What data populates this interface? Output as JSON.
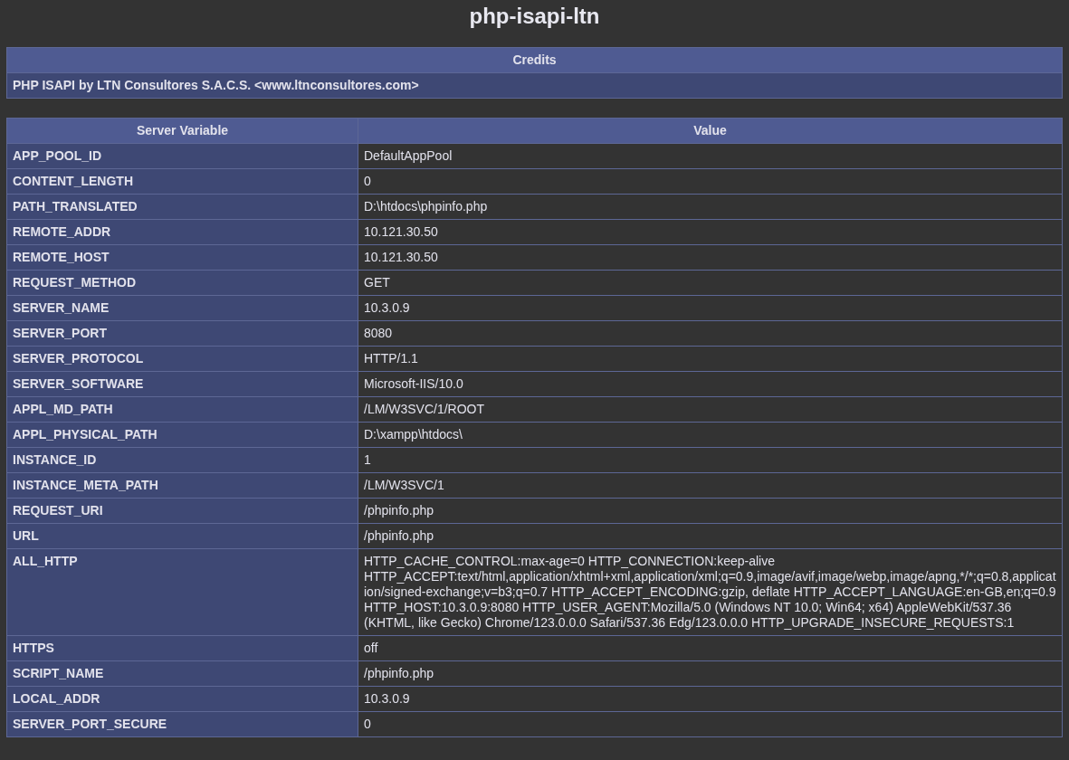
{
  "title": "php-isapi-ltn",
  "credits": {
    "heading": "Credits",
    "text": "PHP ISAPI by LTN Consultores S.A.C.S. <www.ltnconsultores.com>"
  },
  "table": {
    "columns": [
      "Server Variable",
      "Value"
    ],
    "rows": [
      {
        "name": "APP_POOL_ID",
        "value": "DefaultAppPool"
      },
      {
        "name": "CONTENT_LENGTH",
        "value": "0"
      },
      {
        "name": "PATH_TRANSLATED",
        "value": "D:\\htdocs\\phpinfo.php"
      },
      {
        "name": "REMOTE_ADDR",
        "value": "10.121.30.50"
      },
      {
        "name": "REMOTE_HOST",
        "value": "10.121.30.50"
      },
      {
        "name": "REQUEST_METHOD",
        "value": "GET"
      },
      {
        "name": "SERVER_NAME",
        "value": "10.3.0.9"
      },
      {
        "name": "SERVER_PORT",
        "value": "8080"
      },
      {
        "name": "SERVER_PROTOCOL",
        "value": "HTTP/1.1"
      },
      {
        "name": "SERVER_SOFTWARE",
        "value": "Microsoft-IIS/10.0"
      },
      {
        "name": "APPL_MD_PATH",
        "value": "/LM/W3SVC/1/ROOT"
      },
      {
        "name": "APPL_PHYSICAL_PATH",
        "value": "D:\\xampp\\htdocs\\"
      },
      {
        "name": "INSTANCE_ID",
        "value": "1"
      },
      {
        "name": "INSTANCE_META_PATH",
        "value": "/LM/W3SVC/1"
      },
      {
        "name": "REQUEST_URI",
        "value": "/phpinfo.php"
      },
      {
        "name": "URL",
        "value": "/phpinfo.php"
      },
      {
        "name": "ALL_HTTP",
        "value": "HTTP_CACHE_CONTROL:max-age=0 HTTP_CONNECTION:keep-alive HTTP_ACCEPT:text/html,application/xhtml+xml,application/xml;q=0.9,image/avif,image/webp,image/apng,*/*;q=0.8,application/signed-exchange;v=b3;q=0.7 HTTP_ACCEPT_ENCODING:gzip, deflate HTTP_ACCEPT_LANGUAGE:en-GB,en;q=0.9 HTTP_HOST:10.3.0.9:8080 HTTP_USER_AGENT:Mozilla/5.0 (Windows NT 10.0; Win64; x64) AppleWebKit/537.36 (KHTML, like Gecko) Chrome/123.0.0.0 Safari/537.36 Edg/123.0.0.0 HTTP_UPGRADE_INSECURE_REQUESTS:1"
      },
      {
        "name": "HTTPS",
        "value": "off"
      },
      {
        "name": "SCRIPT_NAME",
        "value": "/phpinfo.php"
      },
      {
        "name": "LOCAL_ADDR",
        "value": "10.3.0.9"
      },
      {
        "name": "SERVER_PORT_SECURE",
        "value": "0"
      }
    ]
  }
}
